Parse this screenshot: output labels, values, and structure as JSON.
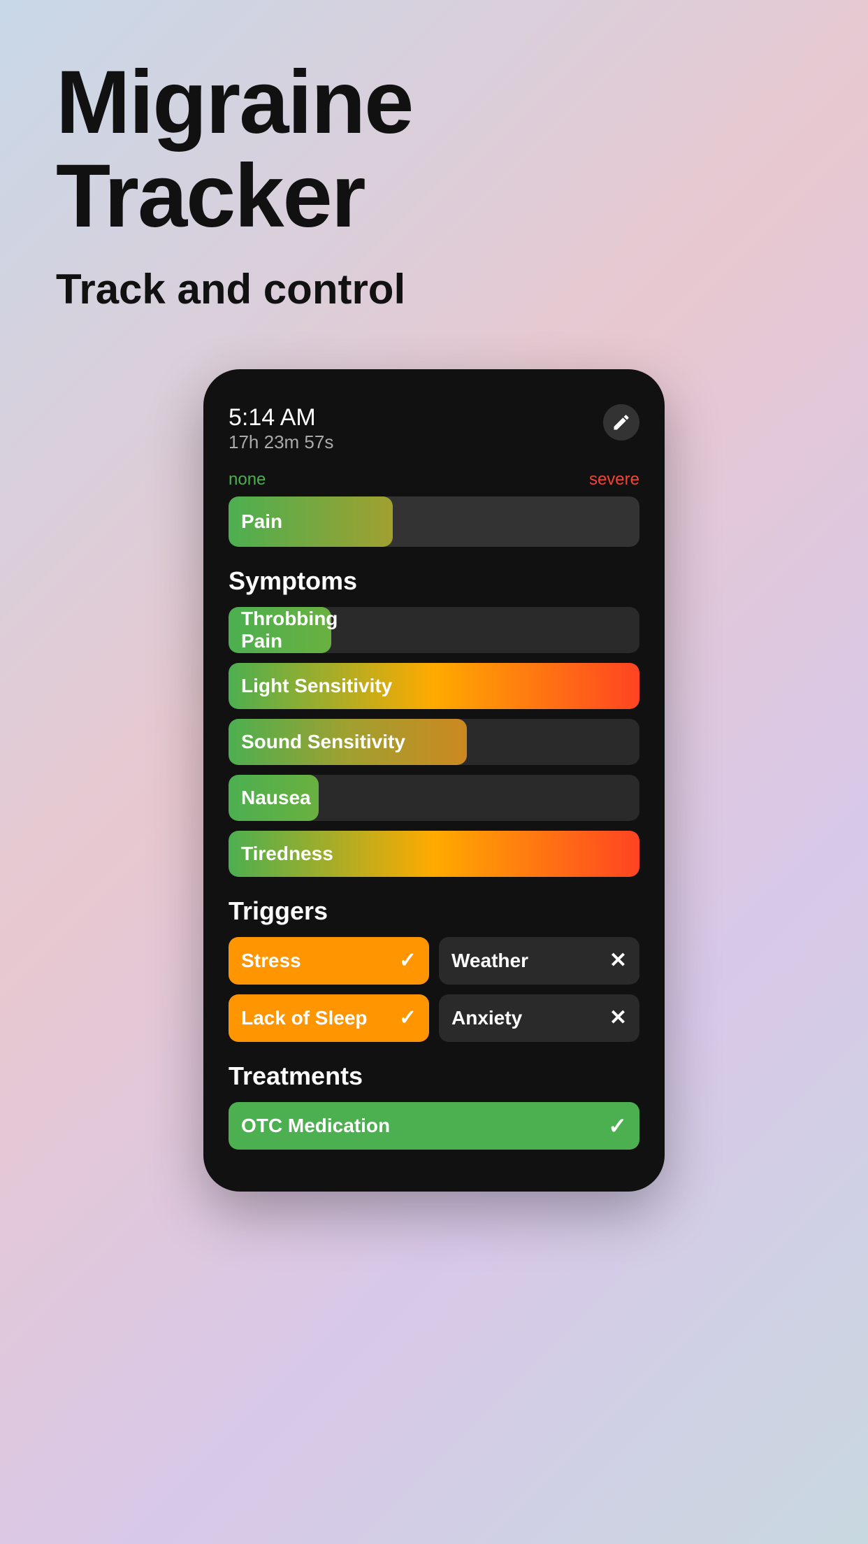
{
  "header": {
    "title_line1": "Migraine",
    "title_line2": "Tracker",
    "subtitle": "Track and control"
  },
  "phone": {
    "time": "5:14 AM",
    "elapsed": "17h 23m 57s",
    "edit_icon": "pencil",
    "pain": {
      "label": "Pain",
      "min_label": "none",
      "max_label": "severe",
      "fill_percent": 40
    },
    "symptoms": {
      "section_title": "Symptoms",
      "items": [
        {
          "name": "Throbbing Pain",
          "fill_percent": 25
        },
        {
          "name": "Light Sensitivity",
          "fill_percent": 100
        },
        {
          "name": "Sound Sensitivity",
          "fill_percent": 58
        },
        {
          "name": "Nausea",
          "fill_percent": 22
        },
        {
          "name": "Tiredness",
          "fill_percent": 100
        }
      ]
    },
    "triggers": {
      "section_title": "Triggers",
      "items": [
        {
          "name": "Stress",
          "active": true,
          "icon": "checkmark"
        },
        {
          "name": "Weather",
          "active": false,
          "icon": "x"
        },
        {
          "name": "Lack of Sleep",
          "active": true,
          "icon": "checkmark"
        },
        {
          "name": "Anxiety",
          "active": false,
          "icon": "x"
        }
      ]
    },
    "treatments": {
      "section_title": "Treatments",
      "items": [
        {
          "name": "OTC Medication",
          "active": true,
          "icon": "checkmark"
        }
      ]
    }
  },
  "colors": {
    "active_trigger": "#ff9500",
    "inactive_trigger": "#2a2a2a",
    "treatment_active": "#4caf50",
    "bar_red": "#ff4422",
    "bar_green": "#4caf50",
    "bar_orange": "#cc8820"
  }
}
